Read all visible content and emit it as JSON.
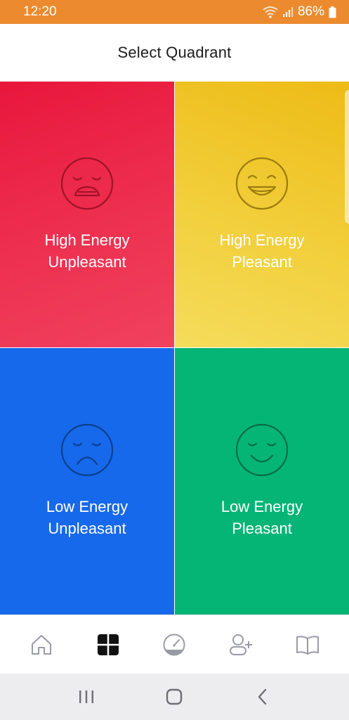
{
  "status_bar": {
    "time": "12:20",
    "battery": "86%"
  },
  "header": {
    "title": "Select Quadrant"
  },
  "quadrants": [
    {
      "line1": "High Energy",
      "line2": "Unpleasant",
      "color": "#E8173C",
      "icon": "tense-face-icon"
    },
    {
      "line1": "High Energy",
      "line2": "Pleasant",
      "color": "#EDBB16",
      "icon": "grinning-face-icon"
    },
    {
      "line1": "Low Energy",
      "line2": "Unpleasant",
      "color": "#1769EB",
      "icon": "sad-face-icon"
    },
    {
      "line1": "Low Energy",
      "line2": "Pleasant",
      "color": "#05B575",
      "icon": "calm-smile-icon"
    }
  ],
  "bottom_nav": {
    "items": [
      "home-icon",
      "quadrant-grid-icon",
      "gauge-icon",
      "add-friend-icon",
      "book-icon"
    ],
    "active": "quadrant-grid-icon"
  },
  "system_nav": [
    "recents-icon",
    "home-button-icon",
    "back-icon"
  ]
}
